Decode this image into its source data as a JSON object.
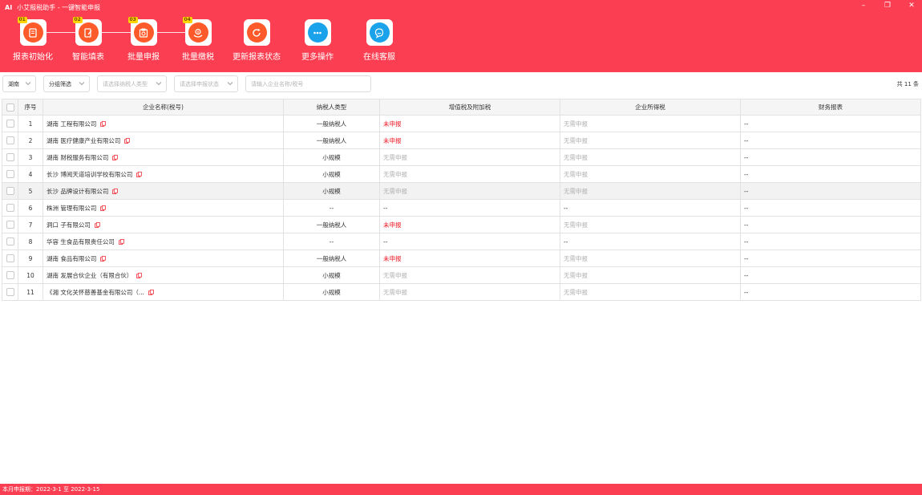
{
  "window": {
    "logo": "AI",
    "title": "小艾报税助手 - 一键智能申报",
    "controls": {
      "minimize": "–",
      "maximize": "❐",
      "close": "✕"
    }
  },
  "toolbar": {
    "items": [
      {
        "label": "报表初始化",
        "step": "01",
        "icon": "report-init-icon"
      },
      {
        "label": "智能填表",
        "step": "02",
        "icon": "smart-fill-icon"
      },
      {
        "label": "批量申报",
        "step": "03",
        "icon": "batch-declare-icon"
      },
      {
        "label": "批量缴税",
        "step": "04",
        "icon": "batch-pay-icon"
      },
      {
        "label": "更新报表状态",
        "icon": "refresh-icon"
      },
      {
        "label": "更多操作",
        "icon": "more-icon"
      },
      {
        "label": "在线客服",
        "icon": "customer-service-icon"
      }
    ],
    "colors": {
      "orange": "#ff5a2a",
      "blue": "#1aa3ea",
      "header": "#fb3e51"
    }
  },
  "filters": {
    "region": "湖南",
    "group": "分组筛选",
    "taxpayer_type_placeholder": "请选择纳税人类型",
    "status_placeholder": "请选择申报状态",
    "search_placeholder": "请输入企业名称/税号",
    "count": "共 11 条"
  },
  "table": {
    "headers": [
      "序号",
      "企业名称(税号)",
      "纳税人类型",
      "增值税及附加税",
      "企业所得税",
      "财务报表"
    ],
    "rows": [
      {
        "idx": "1",
        "name": "湖南 工程有限公司",
        "type": "一般纳税人",
        "vat": "未申报",
        "cit": "无需申报",
        "fs": "--"
      },
      {
        "idx": "2",
        "name": "湖南 医疗健康产业有限公司",
        "type": "一般纳税人",
        "vat": "未申报",
        "cit": "无需申报",
        "fs": "--"
      },
      {
        "idx": "3",
        "name": "湖南 财税服务有限公司",
        "type": "小规模",
        "vat": "无需申报",
        "cit": "无需申报",
        "fs": "--"
      },
      {
        "idx": "4",
        "name": "长沙 博阅天道培训学校有限公司",
        "type": "小规模",
        "vat": "无需申报",
        "cit": "无需申报",
        "fs": "--"
      },
      {
        "idx": "5",
        "name": "长沙 品牌设计有限公司",
        "type": "小规模",
        "vat": "无需申报",
        "cit": "无需申报",
        "fs": "--"
      },
      {
        "idx": "6",
        "name": "株洲 管理有限公司",
        "type": "--",
        "vat": "--",
        "cit": "--",
        "fs": "--"
      },
      {
        "idx": "7",
        "name": "洞口 子有限公司",
        "type": "一般纳税人",
        "vat": "未申报",
        "cit": "无需申报",
        "fs": "--"
      },
      {
        "idx": "8",
        "name": "华容 生食品有限责任公司",
        "type": "--",
        "vat": "--",
        "cit": "--",
        "fs": "--"
      },
      {
        "idx": "9",
        "name": "湖南 食品有限公司",
        "type": "一般纳税人",
        "vat": "未申报",
        "cit": "无需申报",
        "fs": "--"
      },
      {
        "idx": "10",
        "name": "湖南 发展合伙企业（有限合伙）",
        "type": "小规模",
        "vat": "无需申报",
        "cit": "无需申报",
        "fs": "--"
      },
      {
        "idx": "11",
        "name": "《湘 文化关怀慈善基金有限公司（...",
        "type": "小规模",
        "vat": "无需申报",
        "cit": "无需申报",
        "fs": "--"
      }
    ]
  },
  "status": {
    "period": "本月申报期：2022-3-1 至 2022-3-15"
  }
}
